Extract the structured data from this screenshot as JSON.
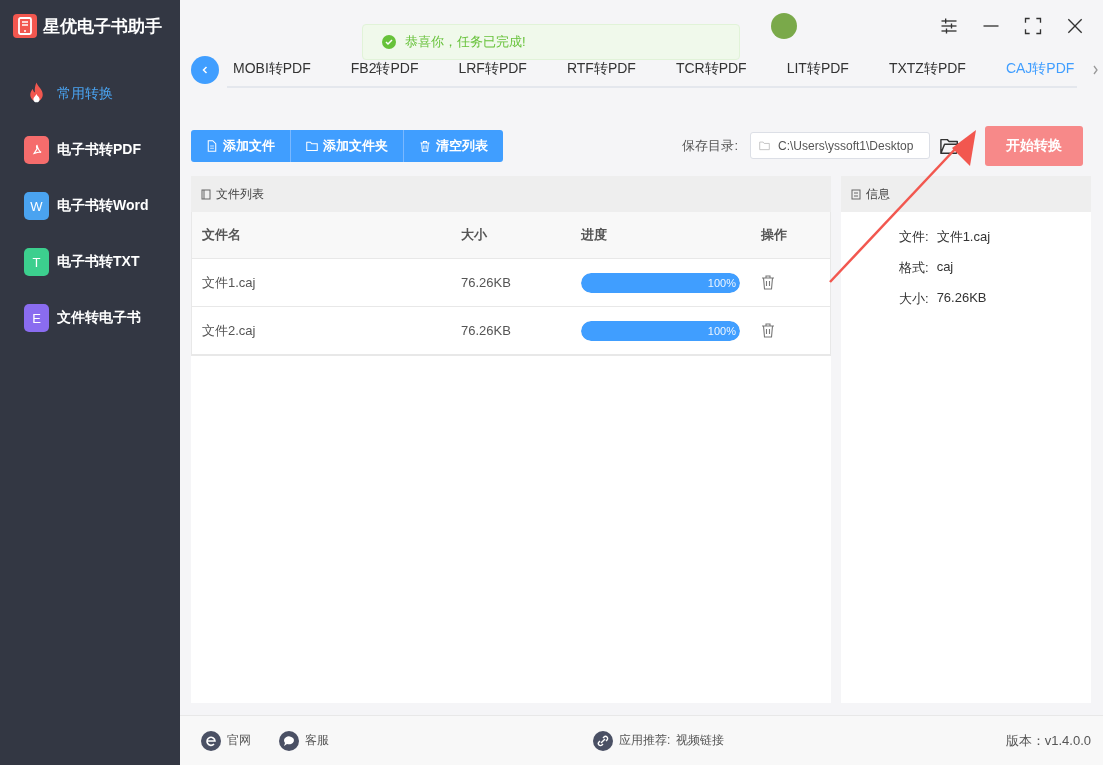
{
  "app": {
    "title": "星优电子书助手"
  },
  "sidebar": {
    "items": [
      {
        "label": "常用转换",
        "kind": "fire",
        "selected": true
      },
      {
        "label": "电子书转PDF",
        "kind": "pdf",
        "color": "#f56c6c",
        "selected": false
      },
      {
        "label": "电子书转Word",
        "kind": "letter",
        "icon_letter": "W",
        "color": "#4aa3f0",
        "selected": false
      },
      {
        "label": "电子书转TXT",
        "kind": "letter",
        "icon_letter": "T",
        "color": "#3ccf8e",
        "selected": false
      },
      {
        "label": "文件转电子书",
        "kind": "letter",
        "icon_letter": "E",
        "color": "#8a6cf0",
        "selected": false
      }
    ]
  },
  "toast": {
    "message": "恭喜你，任务已完成!"
  },
  "tabs": [
    {
      "label": "MOBI转PDF",
      "selected": false
    },
    {
      "label": "FB2转PDF",
      "selected": false
    },
    {
      "label": "LRF转PDF",
      "selected": false
    },
    {
      "label": "RTF转PDF",
      "selected": false
    },
    {
      "label": "TCR转PDF",
      "selected": false
    },
    {
      "label": "LIT转PDF",
      "selected": false
    },
    {
      "label": "TXTZ转PDF",
      "selected": false
    },
    {
      "label": "CAJ转PDF",
      "selected": true
    }
  ],
  "toolbar": {
    "buttons": [
      {
        "label": "添加文件",
        "kind": "file"
      },
      {
        "label": "添加文件夹",
        "kind": "folder"
      },
      {
        "label": "清空列表",
        "kind": "trash"
      }
    ],
    "save_label": "保存目录:",
    "save_path": "C:\\Users\\yssoft1\\Desktop",
    "start_button": "开始转换"
  },
  "file_list": {
    "title": "文件列表",
    "columns": [
      "文件名",
      "大小",
      "进度",
      "操作"
    ],
    "rows": [
      {
        "name": "文件1.caj",
        "size": "76.26KB",
        "level": 1,
        "reading": "100%"
      },
      {
        "name": "文件2.caj",
        "size": "76.26KB",
        "level": 1,
        "reading": "100%"
      }
    ]
  },
  "info": {
    "title": "信息",
    "fields": [
      {
        "label": "文件:",
        "value": "文件1.caj"
      },
      {
        "label": "格式:",
        "value": "caj"
      },
      {
        "label": "大小:",
        "value": "76.26KB"
      }
    ]
  },
  "footer": {
    "website": "官网",
    "support": "客服",
    "recommend_label": "应用推荐:",
    "recommend_link": "视频链接",
    "version": "版本：v1.4.0.0"
  }
}
